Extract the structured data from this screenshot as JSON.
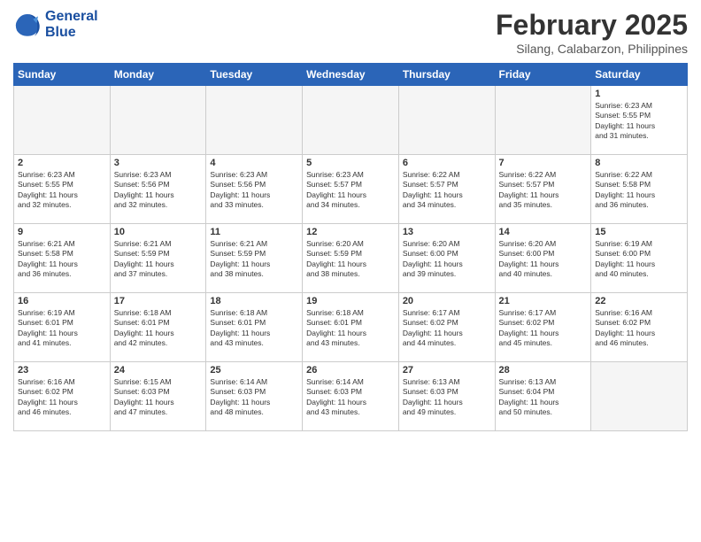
{
  "logo": {
    "line1": "General",
    "line2": "Blue"
  },
  "title": "February 2025",
  "subtitle": "Silang, Calabarzon, Philippines",
  "days_of_week": [
    "Sunday",
    "Monday",
    "Tuesday",
    "Wednesday",
    "Thursday",
    "Friday",
    "Saturday"
  ],
  "weeks": [
    [
      {
        "day": "",
        "info": "",
        "empty": true
      },
      {
        "day": "",
        "info": "",
        "empty": true
      },
      {
        "day": "",
        "info": "",
        "empty": true
      },
      {
        "day": "",
        "info": "",
        "empty": true
      },
      {
        "day": "",
        "info": "",
        "empty": true
      },
      {
        "day": "",
        "info": "",
        "empty": true
      },
      {
        "day": "1",
        "info": "Sunrise: 6:23 AM\nSunset: 5:55 PM\nDaylight: 11 hours\nand 31 minutes."
      }
    ],
    [
      {
        "day": "2",
        "info": "Sunrise: 6:23 AM\nSunset: 5:55 PM\nDaylight: 11 hours\nand 32 minutes."
      },
      {
        "day": "3",
        "info": "Sunrise: 6:23 AM\nSunset: 5:56 PM\nDaylight: 11 hours\nand 32 minutes."
      },
      {
        "day": "4",
        "info": "Sunrise: 6:23 AM\nSunset: 5:56 PM\nDaylight: 11 hours\nand 33 minutes."
      },
      {
        "day": "5",
        "info": "Sunrise: 6:23 AM\nSunset: 5:57 PM\nDaylight: 11 hours\nand 34 minutes."
      },
      {
        "day": "6",
        "info": "Sunrise: 6:22 AM\nSunset: 5:57 PM\nDaylight: 11 hours\nand 34 minutes."
      },
      {
        "day": "7",
        "info": "Sunrise: 6:22 AM\nSunset: 5:57 PM\nDaylight: 11 hours\nand 35 minutes."
      },
      {
        "day": "8",
        "info": "Sunrise: 6:22 AM\nSunset: 5:58 PM\nDaylight: 11 hours\nand 36 minutes."
      }
    ],
    [
      {
        "day": "9",
        "info": "Sunrise: 6:21 AM\nSunset: 5:58 PM\nDaylight: 11 hours\nand 36 minutes."
      },
      {
        "day": "10",
        "info": "Sunrise: 6:21 AM\nSunset: 5:59 PM\nDaylight: 11 hours\nand 37 minutes."
      },
      {
        "day": "11",
        "info": "Sunrise: 6:21 AM\nSunset: 5:59 PM\nDaylight: 11 hours\nand 38 minutes."
      },
      {
        "day": "12",
        "info": "Sunrise: 6:20 AM\nSunset: 5:59 PM\nDaylight: 11 hours\nand 38 minutes."
      },
      {
        "day": "13",
        "info": "Sunrise: 6:20 AM\nSunset: 6:00 PM\nDaylight: 11 hours\nand 39 minutes."
      },
      {
        "day": "14",
        "info": "Sunrise: 6:20 AM\nSunset: 6:00 PM\nDaylight: 11 hours\nand 40 minutes."
      },
      {
        "day": "15",
        "info": "Sunrise: 6:19 AM\nSunset: 6:00 PM\nDaylight: 11 hours\nand 40 minutes."
      }
    ],
    [
      {
        "day": "16",
        "info": "Sunrise: 6:19 AM\nSunset: 6:01 PM\nDaylight: 11 hours\nand 41 minutes."
      },
      {
        "day": "17",
        "info": "Sunrise: 6:18 AM\nSunset: 6:01 PM\nDaylight: 11 hours\nand 42 minutes."
      },
      {
        "day": "18",
        "info": "Sunrise: 6:18 AM\nSunset: 6:01 PM\nDaylight: 11 hours\nand 43 minutes."
      },
      {
        "day": "19",
        "info": "Sunrise: 6:18 AM\nSunset: 6:01 PM\nDaylight: 11 hours\nand 43 minutes."
      },
      {
        "day": "20",
        "info": "Sunrise: 6:17 AM\nSunset: 6:02 PM\nDaylight: 11 hours\nand 44 minutes."
      },
      {
        "day": "21",
        "info": "Sunrise: 6:17 AM\nSunset: 6:02 PM\nDaylight: 11 hours\nand 45 minutes."
      },
      {
        "day": "22",
        "info": "Sunrise: 6:16 AM\nSunset: 6:02 PM\nDaylight: 11 hours\nand 46 minutes."
      }
    ],
    [
      {
        "day": "23",
        "info": "Sunrise: 6:16 AM\nSunset: 6:02 PM\nDaylight: 11 hours\nand 46 minutes."
      },
      {
        "day": "24",
        "info": "Sunrise: 6:15 AM\nSunset: 6:03 PM\nDaylight: 11 hours\nand 47 minutes."
      },
      {
        "day": "25",
        "info": "Sunrise: 6:14 AM\nSunset: 6:03 PM\nDaylight: 11 hours\nand 48 minutes."
      },
      {
        "day": "26",
        "info": "Sunrise: 6:14 AM\nSunset: 6:03 PM\nDaylight: 11 hours\nand 43 minutes."
      },
      {
        "day": "27",
        "info": "Sunrise: 6:13 AM\nSunset: 6:03 PM\nDaylight: 11 hours\nand 49 minutes."
      },
      {
        "day": "28",
        "info": "Sunrise: 6:13 AM\nSunset: 6:04 PM\nDaylight: 11 hours\nand 50 minutes."
      },
      {
        "day": "",
        "info": "",
        "empty": true
      }
    ]
  ]
}
